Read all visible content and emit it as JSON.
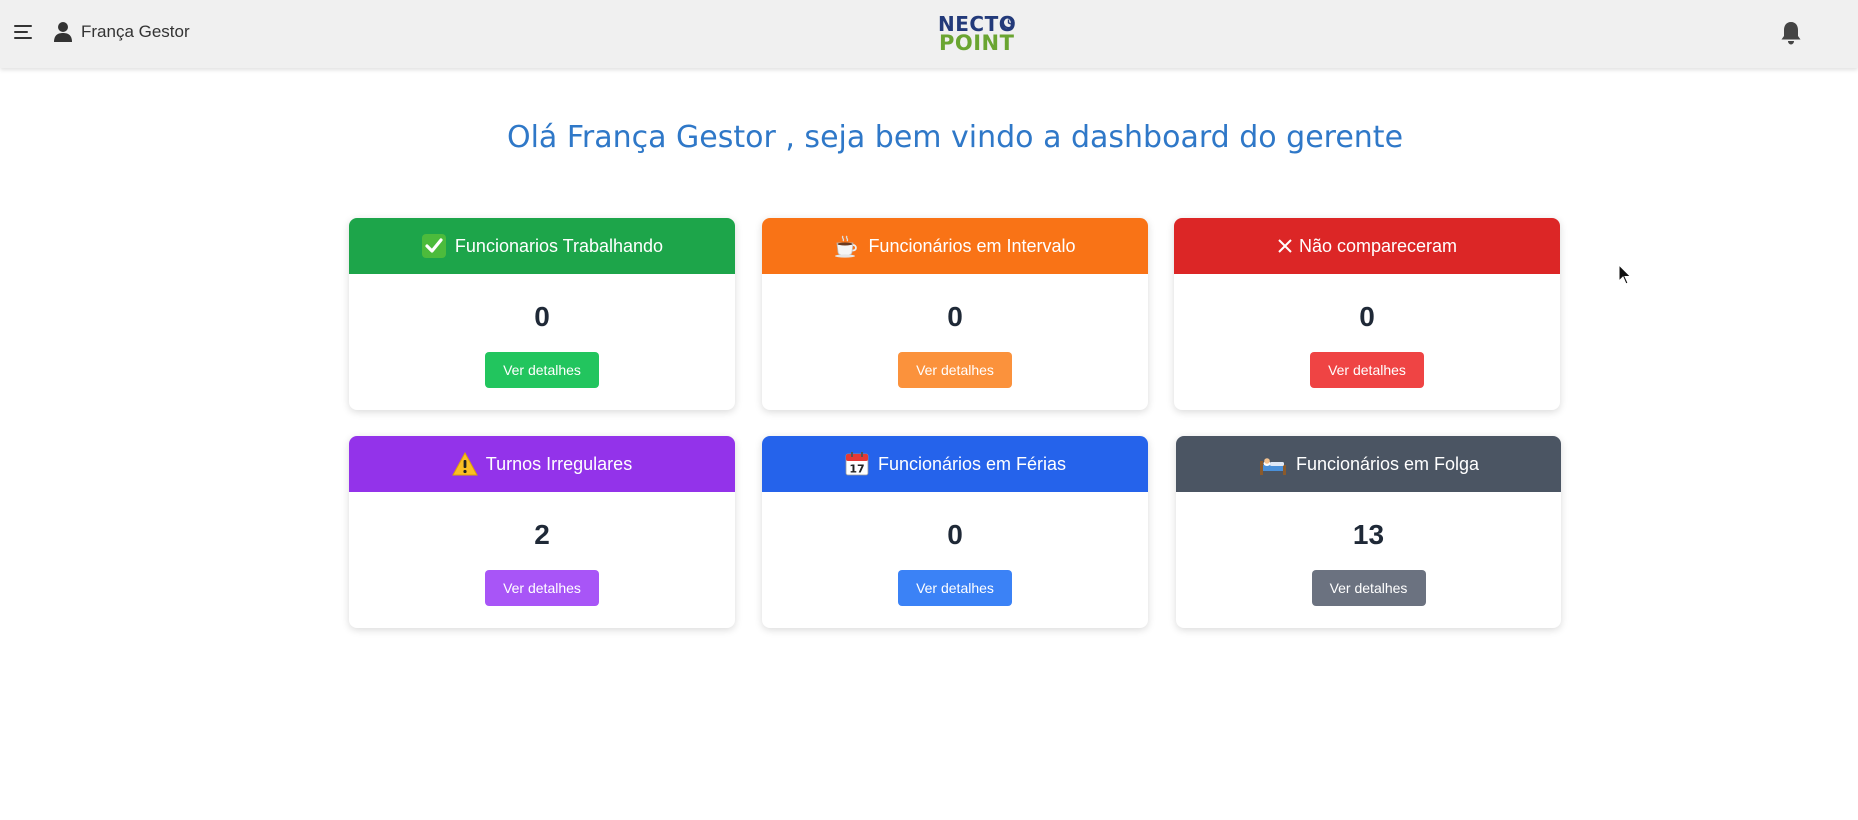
{
  "header": {
    "menu_icon": "hamburger-menu-icon",
    "user_icon": "user-icon",
    "user_name": "França Gestor",
    "logo_top": "NECTO",
    "logo_bottom": "POINT",
    "notification_icon": "bell-icon"
  },
  "welcome": {
    "text": "Olá França Gestor , seja bem vindo a dashboard do gerente"
  },
  "cards": [
    {
      "title": "Funcionarios Trabalhando",
      "icon": "check-icon",
      "value": "0",
      "button": "Ver detalhes",
      "header_color": "#1da54a",
      "button_color": "#22c55e"
    },
    {
      "title": "Funcionários em Intervalo",
      "icon": "coffee-icon",
      "value": "0",
      "button": "Ver detalhes",
      "header_color": "#f97316",
      "button_color": "#fb923c"
    },
    {
      "title": "Não compareceram",
      "icon": "close-icon",
      "value": "0",
      "button": "Ver detalhes",
      "header_color": "#dc2626",
      "button_color": "#ef4444"
    },
    {
      "title": "Turnos Irregulares",
      "icon": "warning-icon",
      "value": "2",
      "button": "Ver detalhes",
      "header_color": "#9333ea",
      "button_color": "#a855f7"
    },
    {
      "title": "Funcionários em Férias",
      "icon": "calendar-icon",
      "value": "0",
      "button": "Ver detalhes",
      "header_color": "#2563eb",
      "button_color": "#3b82f6"
    },
    {
      "title": "Funcionários em Folga",
      "icon": "bed-icon",
      "value": "13",
      "button": "Ver detalhes",
      "header_color": "#4b5563",
      "button_color": "#6b7280"
    }
  ],
  "calendar_day": "17"
}
